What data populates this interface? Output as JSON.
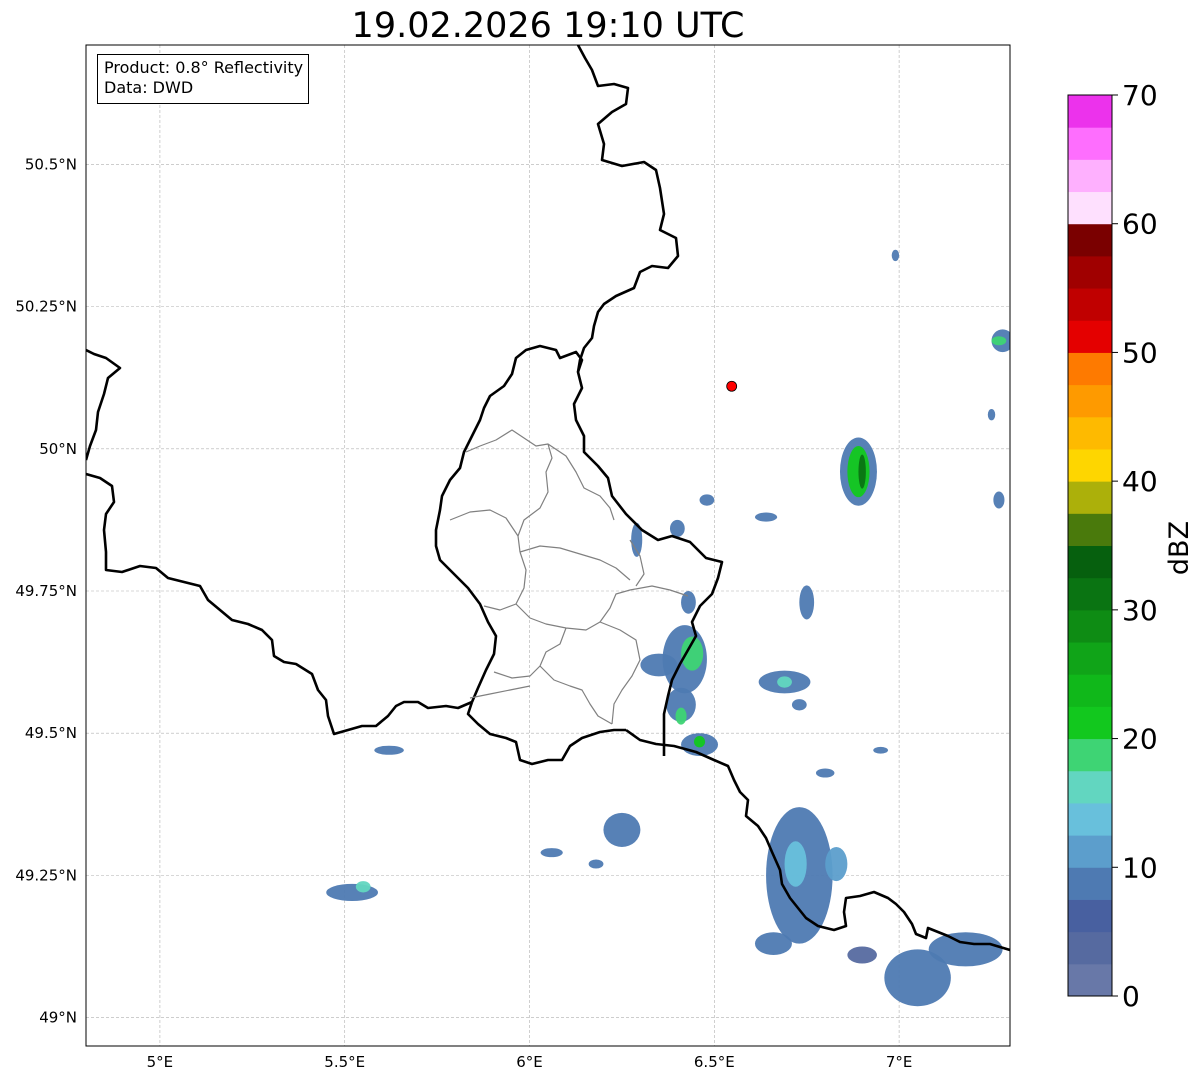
{
  "title": "19.02.2026 19:10 UTC",
  "info": {
    "product": "Product: 0.8° Reflectivity",
    "source": "Data: DWD"
  },
  "map": {
    "lon_range": [
      4.8,
      7.3
    ],
    "lat_range": [
      48.95,
      50.71
    ],
    "lon_ticks": [
      {
        "value": 5.0,
        "label": "5°E"
      },
      {
        "value": 5.5,
        "label": "5.5°E"
      },
      {
        "value": 6.0,
        "label": "6°E"
      },
      {
        "value": 6.5,
        "label": "6.5°E"
      },
      {
        "value": 7.0,
        "label": "7°E"
      }
    ],
    "lat_ticks": [
      {
        "value": 49.0,
        "label": "49°N"
      },
      {
        "value": 49.25,
        "label": "49.25°N"
      },
      {
        "value": 49.5,
        "label": "49.5°N"
      },
      {
        "value": 49.75,
        "label": "49.75°N"
      },
      {
        "value": 50.0,
        "label": "50°N"
      },
      {
        "value": 50.25,
        "label": "50.25°N"
      },
      {
        "value": 50.5,
        "label": "50.5°N"
      }
    ],
    "gridlines": true,
    "radar_site": {
      "lon": 6.547,
      "lat": 50.11,
      "color": "#ff0000"
    }
  },
  "colorbar": {
    "label": "dBZ",
    "min": 0,
    "max": 70,
    "ticks": [
      {
        "value": 0,
        "label": "0"
      },
      {
        "value": 10,
        "label": "10"
      },
      {
        "value": 20,
        "label": "20"
      },
      {
        "value": 30,
        "label": "30"
      },
      {
        "value": 40,
        "label": "40"
      },
      {
        "value": 50,
        "label": "50"
      },
      {
        "value": 60,
        "label": "60"
      },
      {
        "value": 70,
        "label": "70"
      }
    ],
    "colors": [
      "#6878a8",
      "#566aa0",
      "#4860a0",
      "#4e7ab2",
      "#5c9ecc",
      "#68c0dc",
      "#62d6c0",
      "#3ed474",
      "#12c81e",
      "#10b81a",
      "#10a418",
      "#0e8c14",
      "#0a7412",
      "#06600e",
      "#4a7a0c",
      "#acb00a",
      "#fed600",
      "#feba00",
      "#fe9a00",
      "#fe7a00",
      "#e40000",
      "#c00000",
      "#a00000",
      "#7a0000",
      "#fee0fe",
      "#feb0fe",
      "#fe6efe",
      "#ec32ec"
    ]
  },
  "echoes": [
    {
      "lon": 6.73,
      "lat": 49.25,
      "rlon": 0.09,
      "rlat": 0.12,
      "color": "#4e7ab2"
    },
    {
      "lon": 6.72,
      "lat": 49.27,
      "rlon": 0.03,
      "rlat": 0.04,
      "color": "#68c0dc"
    },
    {
      "lon": 6.83,
      "lat": 49.27,
      "rlon": 0.03,
      "rlat": 0.03,
      "color": "#5c9ecc"
    },
    {
      "lon": 6.66,
      "lat": 49.13,
      "rlon": 0.05,
      "rlat": 0.02,
      "color": "#4e7ab2"
    },
    {
      "lon": 7.05,
      "lat": 49.07,
      "rlon": 0.09,
      "rlat": 0.05,
      "color": "#4e7ab2"
    },
    {
      "lon": 7.18,
      "lat": 49.12,
      "rlon": 0.1,
      "rlat": 0.03,
      "color": "#4e7ab2"
    },
    {
      "lon": 6.9,
      "lat": 49.11,
      "rlon": 0.04,
      "rlat": 0.015,
      "color": "#566aa0"
    },
    {
      "lon": 6.25,
      "lat": 49.33,
      "rlon": 0.05,
      "rlat": 0.03,
      "color": "#4e7ab2"
    },
    {
      "lon": 5.52,
      "lat": 49.22,
      "rlon": 0.07,
      "rlat": 0.015,
      "color": "#4e7ab2"
    },
    {
      "lon": 5.55,
      "lat": 49.23,
      "rlon": 0.02,
      "rlat": 0.01,
      "color": "#62d6c0"
    },
    {
      "lon": 6.06,
      "lat": 49.29,
      "rlon": 0.03,
      "rlat": 0.008,
      "color": "#4e7ab2"
    },
    {
      "lon": 6.18,
      "lat": 49.27,
      "rlon": 0.02,
      "rlat": 0.008,
      "color": "#4e7ab2"
    },
    {
      "lon": 5.62,
      "lat": 49.47,
      "rlon": 0.04,
      "rlat": 0.008,
      "color": "#4e7ab2"
    },
    {
      "lon": 6.42,
      "lat": 49.63,
      "rlon": 0.06,
      "rlat": 0.06,
      "color": "#4e7ab2"
    },
    {
      "lon": 6.44,
      "lat": 49.64,
      "rlon": 0.03,
      "rlat": 0.03,
      "color": "#3ed474"
    },
    {
      "lon": 6.41,
      "lat": 49.55,
      "rlon": 0.04,
      "rlat": 0.03,
      "color": "#4e7ab2"
    },
    {
      "lon": 6.41,
      "lat": 49.53,
      "rlon": 0.015,
      "rlat": 0.015,
      "color": "#3ed474"
    },
    {
      "lon": 6.46,
      "lat": 49.48,
      "rlon": 0.05,
      "rlat": 0.02,
      "color": "#4e7ab2"
    },
    {
      "lon": 6.46,
      "lat": 49.485,
      "rlon": 0.015,
      "rlat": 0.01,
      "color": "#12c81e"
    },
    {
      "lon": 6.35,
      "lat": 49.62,
      "rlon": 0.05,
      "rlat": 0.02,
      "color": "#4e7ab2"
    },
    {
      "lon": 6.43,
      "lat": 49.73,
      "rlon": 0.02,
      "rlat": 0.02,
      "color": "#4e7ab2"
    },
    {
      "lon": 6.69,
      "lat": 49.59,
      "rlon": 0.07,
      "rlat": 0.02,
      "color": "#4e7ab2"
    },
    {
      "lon": 6.69,
      "lat": 49.59,
      "rlon": 0.02,
      "rlat": 0.01,
      "color": "#62d6c0"
    },
    {
      "lon": 6.73,
      "lat": 49.55,
      "rlon": 0.02,
      "rlat": 0.01,
      "color": "#4e7ab2"
    },
    {
      "lon": 6.75,
      "lat": 49.73,
      "rlon": 0.02,
      "rlat": 0.03,
      "color": "#4e7ab2"
    },
    {
      "lon": 6.89,
      "lat": 49.96,
      "rlon": 0.05,
      "rlat": 0.06,
      "color": "#4e7ab2"
    },
    {
      "lon": 6.89,
      "lat": 49.96,
      "rlon": 0.03,
      "rlat": 0.045,
      "color": "#12c81e"
    },
    {
      "lon": 6.9,
      "lat": 49.96,
      "rlon": 0.01,
      "rlat": 0.03,
      "color": "#0a7412"
    },
    {
      "lon": 6.29,
      "lat": 49.84,
      "rlon": 0.015,
      "rlat": 0.03,
      "color": "#4e7ab2"
    },
    {
      "lon": 6.4,
      "lat": 49.86,
      "rlon": 0.02,
      "rlat": 0.015,
      "color": "#4e7ab2"
    },
    {
      "lon": 6.48,
      "lat": 49.91,
      "rlon": 0.02,
      "rlat": 0.01,
      "color": "#4e7ab2"
    },
    {
      "lon": 6.64,
      "lat": 49.88,
      "rlon": 0.03,
      "rlat": 0.008,
      "color": "#4e7ab2"
    },
    {
      "lon": 7.28,
      "lat": 50.19,
      "rlon": 0.03,
      "rlat": 0.02,
      "color": "#4e7ab2"
    },
    {
      "lon": 7.27,
      "lat": 50.19,
      "rlon": 0.02,
      "rlat": 0.008,
      "color": "#3ed474"
    },
    {
      "lon": 6.8,
      "lat": 49.43,
      "rlon": 0.025,
      "rlat": 0.008,
      "color": "#4e7ab2"
    },
    {
      "lon": 6.95,
      "lat": 49.47,
      "rlon": 0.02,
      "rlat": 0.006,
      "color": "#4e7ab2"
    },
    {
      "lon": 6.99,
      "lat": 50.34,
      "rlon": 0.01,
      "rlat": 0.01,
      "color": "#4e7ab2"
    },
    {
      "lon": 7.27,
      "lat": 49.91,
      "rlon": 0.015,
      "rlat": 0.015,
      "color": "#4e7ab2"
    },
    {
      "lon": 7.25,
      "lat": 50.06,
      "rlon": 0.01,
      "rlat": 0.01,
      "color": "#4e7ab2"
    }
  ]
}
